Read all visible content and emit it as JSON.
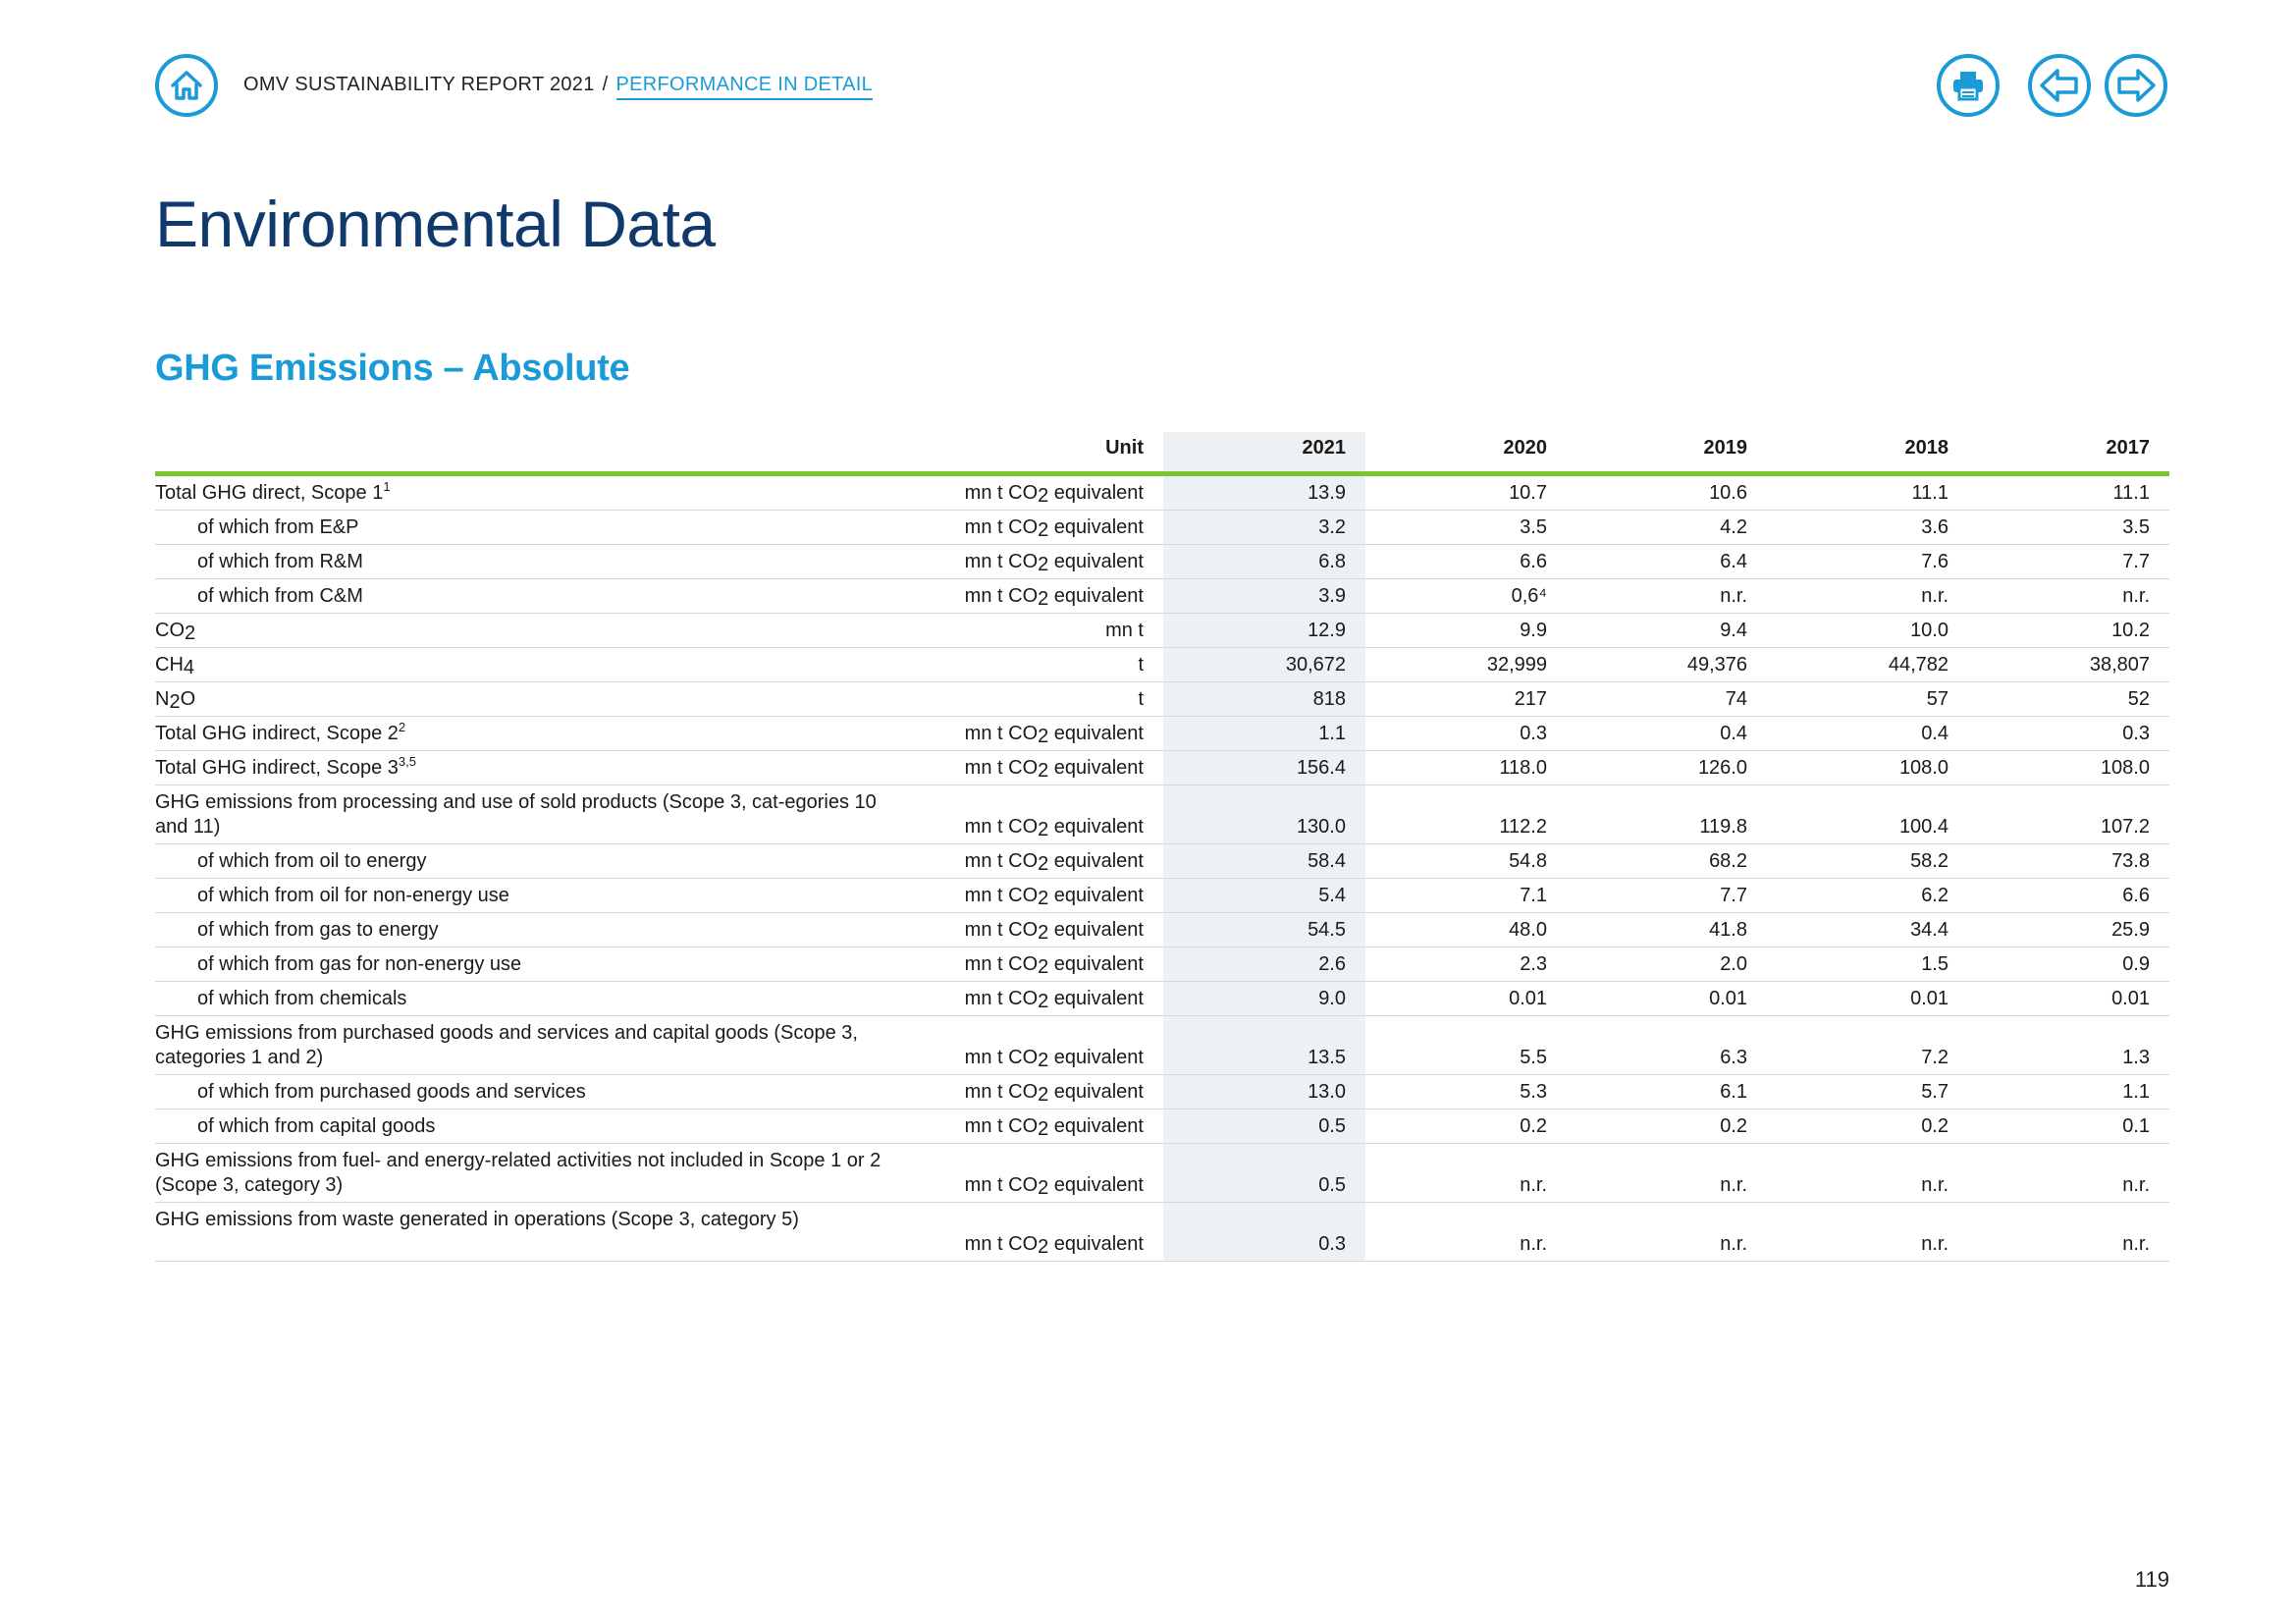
{
  "header": {
    "breadcrumb_root": "OMV SUSTAINABILITY REPORT 2021",
    "breadcrumb_sep": "/",
    "breadcrumb_current": "PERFORMANCE IN DETAIL",
    "icons": [
      "home-icon",
      "print-icon",
      "arrow-left-icon",
      "arrow-right-icon"
    ],
    "accent_color": "#1a9bd7"
  },
  "page_title": "Environmental Data",
  "section_title": "GHG Emissions – Absolute",
  "table": {
    "columns": {
      "unit": "Unit",
      "years": [
        "2021",
        "2020",
        "2019",
        "2018",
        "2017"
      ]
    },
    "rows": [
      {
        "label": "Total GHG direct, Scope 1",
        "sup": "1",
        "indent": false,
        "unit": "mn t CO2 equivalent",
        "values": [
          "13.9",
          "10.7",
          "10.6",
          "11.1",
          "11.1"
        ]
      },
      {
        "label": "of which from E&P",
        "indent": true,
        "unit": "mn t CO2 equivalent",
        "values": [
          "3.2",
          "3.5",
          "4.2",
          "3.6",
          "3.5"
        ]
      },
      {
        "label": "of which from R&M",
        "indent": true,
        "unit": "mn t CO2 equivalent",
        "values": [
          "6.8",
          "6.6",
          "6.4",
          "7.6",
          "7.7"
        ]
      },
      {
        "label": "of which from C&M",
        "indent": true,
        "unit": "mn t CO2 equivalent",
        "values": [
          "3.9",
          "0,6⁴",
          "n.r.",
          "n.r.",
          "n.r."
        ]
      },
      {
        "label": "CO2",
        "indent": false,
        "unit": "mn t",
        "values": [
          "12.9",
          "9.9",
          "9.4",
          "10.0",
          "10.2"
        ]
      },
      {
        "label": "CH4",
        "indent": false,
        "unit": "t",
        "values": [
          "30,672",
          "32,999",
          "49,376",
          "44,782",
          "38,807"
        ]
      },
      {
        "label": "N2O",
        "indent": false,
        "unit": "t",
        "values": [
          "818",
          "217",
          "74",
          "57",
          "52"
        ]
      },
      {
        "label": "Total GHG indirect, Scope 2",
        "sup": "2",
        "indent": false,
        "unit": "mn t CO2 equivalent",
        "values": [
          "1.1",
          "0.3",
          "0.4",
          "0.4",
          "0.3"
        ]
      },
      {
        "label": "Total GHG indirect, Scope 3",
        "sup": "3,5",
        "indent": false,
        "unit": "mn t CO2 equivalent",
        "values": [
          "156.4",
          "118.0",
          "126.0",
          "108.0",
          "108.0"
        ]
      },
      {
        "label": "GHG emissions from processing and use of sold products (Scope 3, cat-egories 10 and 11)",
        "indent": false,
        "tall": true,
        "unit": "mn t CO2 equivalent",
        "values": [
          "130.0",
          "112.2",
          "119.8",
          "100.4",
          "107.2"
        ]
      },
      {
        "label": "of which from oil to energy",
        "indent": true,
        "unit": "mn t CO2 equivalent",
        "values": [
          "58.4",
          "54.8",
          "68.2",
          "58.2",
          "73.8"
        ]
      },
      {
        "label": "of which from oil for non-energy use",
        "indent": true,
        "unit": "mn t CO2 equivalent",
        "values": [
          "5.4",
          "7.1",
          "7.7",
          "6.2",
          "6.6"
        ]
      },
      {
        "label": "of which from gas to energy",
        "indent": true,
        "unit": "mn t CO2 equivalent",
        "values": [
          "54.5",
          "48.0",
          "41.8",
          "34.4",
          "25.9"
        ]
      },
      {
        "label": "of which from gas for non-energy use",
        "indent": true,
        "unit": "mn t CO2 equivalent",
        "values": [
          "2.6",
          "2.3",
          "2.0",
          "1.5",
          "0.9"
        ]
      },
      {
        "label": "of which from chemicals",
        "indent": true,
        "unit": "mn t CO2 equivalent",
        "values": [
          "9.0",
          "0.01",
          "0.01",
          "0.01",
          "0.01"
        ]
      },
      {
        "label": "GHG emissions from purchased goods and services and capital goods (Scope 3, categories 1 and 2)",
        "indent": false,
        "tall": true,
        "unit": "mn t CO2 equivalent",
        "values": [
          "13.5",
          "5.5",
          "6.3",
          "7.2",
          "1.3"
        ]
      },
      {
        "label": "of which from purchased goods and services",
        "indent": true,
        "unit": "mn t CO2 equivalent",
        "values": [
          "13.0",
          "5.3",
          "6.1",
          "5.7",
          "1.1"
        ]
      },
      {
        "label": "of which from capital goods",
        "indent": true,
        "unit": "mn t CO2 equivalent",
        "values": [
          "0.5",
          "0.2",
          "0.2",
          "0.2",
          "0.1"
        ]
      },
      {
        "label": "GHG emissions from fuel- and energy-related activities not included in Scope 1 or 2 (Scope 3, category 3)",
        "indent": false,
        "tall": true,
        "unit": "mn t CO2 equivalent",
        "values": [
          "0.5",
          "n.r.",
          "n.r.",
          "n.r.",
          "n.r."
        ]
      },
      {
        "label": "GHG emissions from waste generated in operations (Scope 3, category 5)",
        "indent": false,
        "tall": true,
        "unit": "mn t CO2 equivalent",
        "values": [
          "0.3",
          "n.r.",
          "n.r.",
          "n.r.",
          "n.r."
        ]
      }
    ]
  },
  "page_number": "119"
}
